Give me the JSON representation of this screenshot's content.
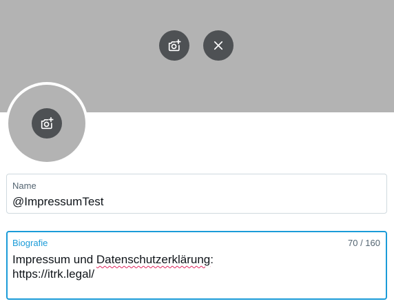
{
  "banner": {
    "add_photo_icon": "camera-plus-icon",
    "remove_icon": "close-icon",
    "background_color": "#b3b3b3"
  },
  "avatar": {
    "add_photo_icon": "camera-plus-icon"
  },
  "name_field": {
    "label": "Name",
    "value": "@ImpressumTest"
  },
  "bio_field": {
    "label": "Biografie",
    "counter": "70 / 160",
    "value_line1_prefix": "Impressum und ",
    "value_line1_misspelled": "Datenschutzerklärung",
    "value_line1_suffix": ":",
    "value_line2": "https://itrk.legal/",
    "focus_color": "#1a9bd8"
  }
}
